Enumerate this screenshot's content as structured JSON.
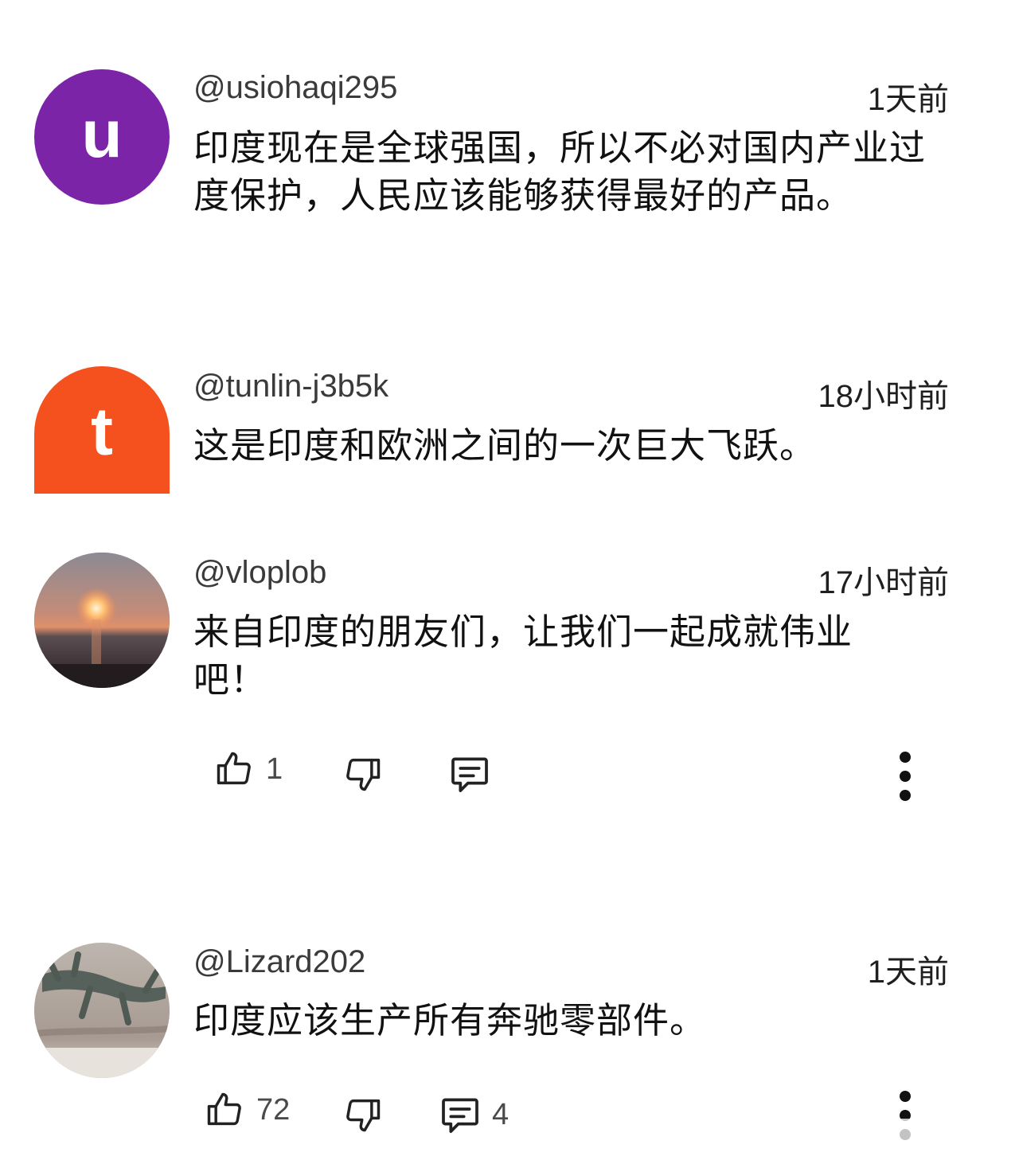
{
  "comments": [
    {
      "username": "@usiohaqi295",
      "time": "1天前",
      "text": "印度现在是全球强国，所以不必对国内产业过度保护，人民应该能够获得最好的产品。",
      "avatar": {
        "letter": "u",
        "color": "#7b24a8"
      }
    },
    {
      "username": "@tunlin-j3b5k",
      "time": "18小时前",
      "text": "这是印度和欧洲之间的一次巨大飞跃。",
      "avatar": {
        "letter": "t",
        "color": "#f4511e"
      }
    },
    {
      "username": "@vloplob",
      "time": "17小时前",
      "text": "来自印度的朋友们，让我们一起成就伟业吧！",
      "avatar": {
        "image": "sunset-photo"
      },
      "actions": {
        "likes": "1",
        "replies": ""
      }
    },
    {
      "username": "@Lizard202",
      "time": "1天前",
      "text": "印度应该生产所有奔驰零部件。",
      "avatar": {
        "image": "lizard-photo"
      },
      "actions": {
        "likes": "72",
        "replies": "4"
      }
    }
  ],
  "icons": {
    "like": "thumbs-up-icon",
    "dislike": "thumbs-down-icon",
    "reply": "comment-icon",
    "more": "more-vert-icon"
  }
}
